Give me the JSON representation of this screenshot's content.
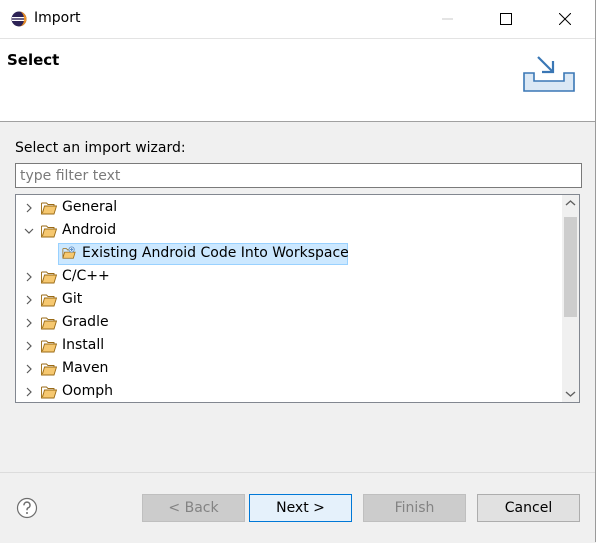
{
  "window": {
    "title": "Import",
    "icon": "eclipse-icon"
  },
  "header": {
    "title": "Select",
    "icon": "import-tray-icon"
  },
  "wizard": {
    "label": "Select an import wizard:",
    "filter_placeholder": "type filter text",
    "filter_value": ""
  },
  "tree": {
    "items": [
      {
        "label": "General",
        "expanded": false,
        "level": 0,
        "type": "folder"
      },
      {
        "label": "Android",
        "expanded": true,
        "level": 0,
        "type": "folder"
      },
      {
        "label": "Existing Android Code Into Workspace",
        "level": 1,
        "type": "wizard",
        "selected": true
      },
      {
        "label": "C/C++",
        "expanded": false,
        "level": 0,
        "type": "folder"
      },
      {
        "label": "Git",
        "expanded": false,
        "level": 0,
        "type": "folder"
      },
      {
        "label": "Gradle",
        "expanded": false,
        "level": 0,
        "type": "folder"
      },
      {
        "label": "Install",
        "expanded": false,
        "level": 0,
        "type": "folder"
      },
      {
        "label": "Maven",
        "expanded": false,
        "level": 0,
        "type": "folder"
      },
      {
        "label": "Oomph",
        "expanded": false,
        "level": 0,
        "type": "folder"
      }
    ]
  },
  "buttons": {
    "back": "< Back",
    "next": "Next >",
    "finish": "Finish",
    "cancel": "Cancel"
  },
  "colors": {
    "selection": "#cce8ff",
    "default_button_border": "#0078d7",
    "folder": "#e8a33d"
  }
}
